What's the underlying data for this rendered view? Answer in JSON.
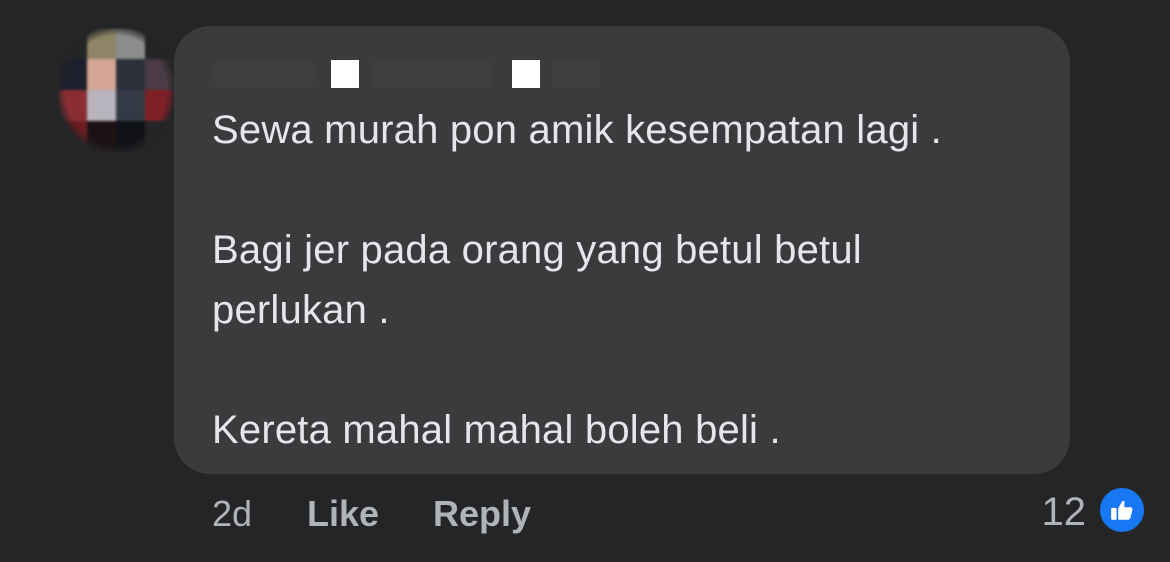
{
  "comment": {
    "author": "",
    "lines": [
      "Sewa murah pon amik kesempatan lagi .",
      "Bagi jer pada orang yang betul betul",
      "perlukan .",
      "Kereta mahal mahal boleh beli ."
    ]
  },
  "actions": {
    "time": "2d",
    "like_label": "Like",
    "reply_label": "Reply"
  },
  "reactions": {
    "count": "12",
    "icon": "thumbs-up-icon",
    "color": "#1877f2"
  },
  "avatar": {
    "icon": "pixelated-avatar",
    "colors": [
      "#242526",
      "#8e8466",
      "#8c8c8c",
      "#242526",
      "#1d1f2c",
      "#d4a593",
      "#2a2f3a",
      "#4a3b44",
      "#8a2e33",
      "#b7b4bd",
      "#343a45",
      "#7e2026",
      "#6e1c22",
      "#1c1214",
      "#101217",
      "#242526"
    ]
  },
  "theme": {
    "background": "#242526",
    "bubble": "#3a3b3c",
    "text": "#e4e6eb",
    "secondary_text": "#b0b3b8"
  }
}
